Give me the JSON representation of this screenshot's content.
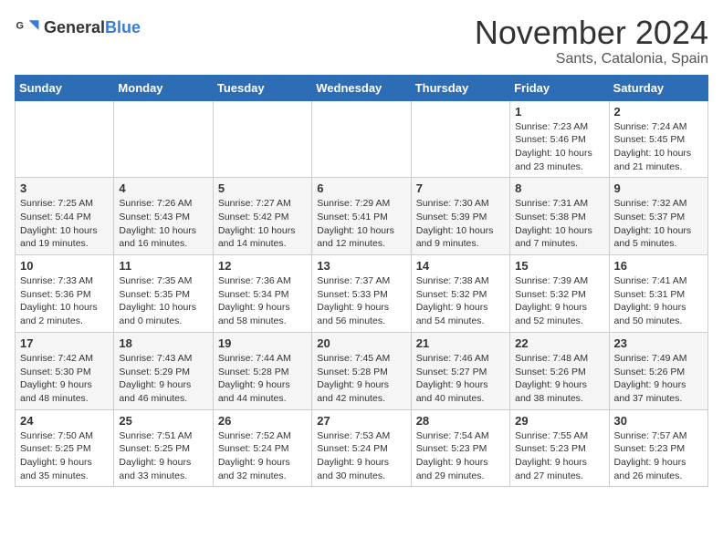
{
  "logo": {
    "text_general": "General",
    "text_blue": "Blue"
  },
  "header": {
    "month": "November 2024",
    "location": "Sants, Catalonia, Spain"
  },
  "days_of_week": [
    "Sunday",
    "Monday",
    "Tuesday",
    "Wednesday",
    "Thursday",
    "Friday",
    "Saturday"
  ],
  "weeks": [
    [
      {
        "day": "",
        "info": ""
      },
      {
        "day": "",
        "info": ""
      },
      {
        "day": "",
        "info": ""
      },
      {
        "day": "",
        "info": ""
      },
      {
        "day": "",
        "info": ""
      },
      {
        "day": "1",
        "info": "Sunrise: 7:23 AM\nSunset: 5:46 PM\nDaylight: 10 hours and 23 minutes."
      },
      {
        "day": "2",
        "info": "Sunrise: 7:24 AM\nSunset: 5:45 PM\nDaylight: 10 hours and 21 minutes."
      }
    ],
    [
      {
        "day": "3",
        "info": "Sunrise: 7:25 AM\nSunset: 5:44 PM\nDaylight: 10 hours and 19 minutes."
      },
      {
        "day": "4",
        "info": "Sunrise: 7:26 AM\nSunset: 5:43 PM\nDaylight: 10 hours and 16 minutes."
      },
      {
        "day": "5",
        "info": "Sunrise: 7:27 AM\nSunset: 5:42 PM\nDaylight: 10 hours and 14 minutes."
      },
      {
        "day": "6",
        "info": "Sunrise: 7:29 AM\nSunset: 5:41 PM\nDaylight: 10 hours and 12 minutes."
      },
      {
        "day": "7",
        "info": "Sunrise: 7:30 AM\nSunset: 5:39 PM\nDaylight: 10 hours and 9 minutes."
      },
      {
        "day": "8",
        "info": "Sunrise: 7:31 AM\nSunset: 5:38 PM\nDaylight: 10 hours and 7 minutes."
      },
      {
        "day": "9",
        "info": "Sunrise: 7:32 AM\nSunset: 5:37 PM\nDaylight: 10 hours and 5 minutes."
      }
    ],
    [
      {
        "day": "10",
        "info": "Sunrise: 7:33 AM\nSunset: 5:36 PM\nDaylight: 10 hours and 2 minutes."
      },
      {
        "day": "11",
        "info": "Sunrise: 7:35 AM\nSunset: 5:35 PM\nDaylight: 10 hours and 0 minutes."
      },
      {
        "day": "12",
        "info": "Sunrise: 7:36 AM\nSunset: 5:34 PM\nDaylight: 9 hours and 58 minutes."
      },
      {
        "day": "13",
        "info": "Sunrise: 7:37 AM\nSunset: 5:33 PM\nDaylight: 9 hours and 56 minutes."
      },
      {
        "day": "14",
        "info": "Sunrise: 7:38 AM\nSunset: 5:32 PM\nDaylight: 9 hours and 54 minutes."
      },
      {
        "day": "15",
        "info": "Sunrise: 7:39 AM\nSunset: 5:32 PM\nDaylight: 9 hours and 52 minutes."
      },
      {
        "day": "16",
        "info": "Sunrise: 7:41 AM\nSunset: 5:31 PM\nDaylight: 9 hours and 50 minutes."
      }
    ],
    [
      {
        "day": "17",
        "info": "Sunrise: 7:42 AM\nSunset: 5:30 PM\nDaylight: 9 hours and 48 minutes."
      },
      {
        "day": "18",
        "info": "Sunrise: 7:43 AM\nSunset: 5:29 PM\nDaylight: 9 hours and 46 minutes."
      },
      {
        "day": "19",
        "info": "Sunrise: 7:44 AM\nSunset: 5:28 PM\nDaylight: 9 hours and 44 minutes."
      },
      {
        "day": "20",
        "info": "Sunrise: 7:45 AM\nSunset: 5:28 PM\nDaylight: 9 hours and 42 minutes."
      },
      {
        "day": "21",
        "info": "Sunrise: 7:46 AM\nSunset: 5:27 PM\nDaylight: 9 hours and 40 minutes."
      },
      {
        "day": "22",
        "info": "Sunrise: 7:48 AM\nSunset: 5:26 PM\nDaylight: 9 hours and 38 minutes."
      },
      {
        "day": "23",
        "info": "Sunrise: 7:49 AM\nSunset: 5:26 PM\nDaylight: 9 hours and 37 minutes."
      }
    ],
    [
      {
        "day": "24",
        "info": "Sunrise: 7:50 AM\nSunset: 5:25 PM\nDaylight: 9 hours and 35 minutes."
      },
      {
        "day": "25",
        "info": "Sunrise: 7:51 AM\nSunset: 5:25 PM\nDaylight: 9 hours and 33 minutes."
      },
      {
        "day": "26",
        "info": "Sunrise: 7:52 AM\nSunset: 5:24 PM\nDaylight: 9 hours and 32 minutes."
      },
      {
        "day": "27",
        "info": "Sunrise: 7:53 AM\nSunset: 5:24 PM\nDaylight: 9 hours and 30 minutes."
      },
      {
        "day": "28",
        "info": "Sunrise: 7:54 AM\nSunset: 5:23 PM\nDaylight: 9 hours and 29 minutes."
      },
      {
        "day": "29",
        "info": "Sunrise: 7:55 AM\nSunset: 5:23 PM\nDaylight: 9 hours and 27 minutes."
      },
      {
        "day": "30",
        "info": "Sunrise: 7:57 AM\nSunset: 5:23 PM\nDaylight: 9 hours and 26 minutes."
      }
    ]
  ]
}
